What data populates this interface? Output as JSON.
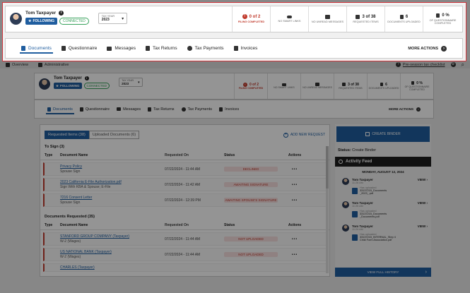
{
  "user": {
    "name": "Tom Taxpayer",
    "following_label": "FOLLOWING",
    "connection_status": "CONNECTED"
  },
  "tax_year": {
    "label": "TAX YEAR",
    "value": "2023"
  },
  "stats": {
    "filing": {
      "value": "0 of 2",
      "label": "FILING COMPLETED"
    },
    "smart_links": {
      "label": "NO SMART LINKS"
    },
    "messages": {
      "label": "NO UNREAD MESSAGES"
    },
    "requested": {
      "value": "3 of 38",
      "label": "REQUESTED ITEMS"
    },
    "uploaded": {
      "value": "6",
      "label": "DOCUMENTS UPLOADED"
    },
    "questionnaire": {
      "value": "0 %",
      "label": "OF QUESTIONNAIRE COMPLETED"
    }
  },
  "tabs": [
    {
      "label": "Documents",
      "icon": "documents-icon",
      "active": true
    },
    {
      "label": "Questionnaire",
      "icon": "questionnaire-icon",
      "active": false
    },
    {
      "label": "Messages",
      "icon": "messages-icon",
      "active": false
    },
    {
      "label": "Tax Returns",
      "icon": "tax-returns-icon",
      "active": false
    },
    {
      "label": "Tax Payments",
      "icon": "tax-payments-icon",
      "active": false
    },
    {
      "label": "Invoices",
      "icon": "invoices-icon",
      "active": false
    }
  ],
  "more_actions": "MORE ACTIONS",
  "app_nav": {
    "overview": "Overview",
    "administrative": "Administrative",
    "checklist": "Pre-season tax checklist"
  },
  "doc_tabs": {
    "requested": "Requested Items (38)",
    "uploaded": "Uploaded Documents (6)"
  },
  "add_new_request": "ADD NEW REQUEST",
  "columns": {
    "type": "Type",
    "document": "Document Name",
    "requested": "Requested On",
    "status": "Status",
    "actions": "Actions"
  },
  "to_sign": {
    "title": "To Sign (3)",
    "rows": [
      {
        "name": "Privacy Policy",
        "sub": "Spouse Sign",
        "date": "07/22/2024 - 11:44 AM",
        "status": "DECLINED"
      },
      {
        "name": "2023 California E-File Authorization.pdf",
        "sub": "Sign With KBA & Spouse; E-File",
        "date": "07/22/2024 - 11:42 AM",
        "status": "AWAITING SIGNATURE"
      },
      {
        "name": "7216 Consent Letter",
        "sub": "Spouse Sign",
        "date": "07/22/2024 - 12:39 PM",
        "status": "AWAITING SPOUSE'S SIGNATURE"
      }
    ]
  },
  "docs_requested": {
    "title": "Documents Requested (35)",
    "rows": [
      {
        "name": "STANFORD GROUP COMPANY (Taxpayer)",
        "sub": "W-2 (Wages)",
        "date": "07/22/2024 - 11:44 AM",
        "status": "NOT UPLOADED"
      },
      {
        "name": "US NATIONAL BANK (Taxpayer)",
        "sub": "W-2 (Wages)",
        "date": "07/22/2024 - 11:44 AM",
        "status": "NOT UPLOADED"
      },
      {
        "name": "CHARLES (Taxpayer)",
        "sub": "",
        "date": "07/22/2024 - 11:44 AM",
        "status": "NOT UPLOADED"
      }
    ]
  },
  "right_panel": {
    "create_binder": "CREATE BINDER",
    "status_label": "Status:",
    "status_value": "Create Binder",
    "activity_feed": "Activity Feed",
    "date": "MONDAY, AUGUST 12, 2024",
    "feed": [
      {
        "name": "Tom Taxpayer",
        "time": "11:28 AM",
        "action": "Has uploaded",
        "file": "33137215_Documents",
        "file2": "_2023_.pdf",
        "view": "VIEW"
      },
      {
        "name": "Tom Taxpayer",
        "time": "11:26 AM",
        "action": "Has uploaded",
        "file": "33137215_Documents",
        "file2": "_Documents.pdf",
        "view": "VIEW"
      },
      {
        "name": "Tom Taxpayer",
        "time": "11:24 AM",
        "action": "Has uploaded",
        "file": "33137215_INTERNAL_Step 4",
        "file2": "Child Form Association.pdf",
        "view": "VIEW"
      }
    ],
    "view_full_history": "VIEW FULL HISTORY"
  }
}
